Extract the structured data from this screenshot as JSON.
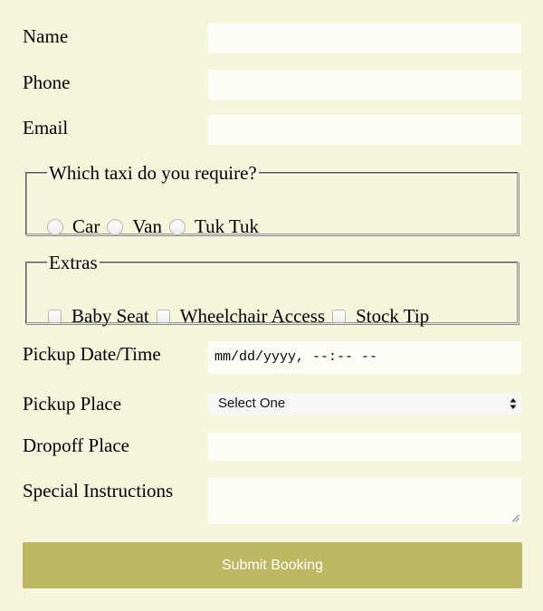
{
  "fields": {
    "name": {
      "label": "Name",
      "value": ""
    },
    "phone": {
      "label": "Phone",
      "value": ""
    },
    "email": {
      "label": "Email",
      "value": ""
    },
    "pickup_datetime": {
      "label": "Pickup Date/Time",
      "placeholder": "mm/dd/yyyy, --:-- --"
    },
    "pickup_place": {
      "label": "Pickup Place",
      "selected": "Select One"
    },
    "dropoff_place": {
      "label": "Dropoff Place",
      "value": ""
    },
    "special_instructions": {
      "label": "Special Instructions",
      "value": ""
    }
  },
  "taxi_group": {
    "legend": "Which taxi do you require?",
    "options": [
      {
        "label": "Car",
        "checked": false
      },
      {
        "label": "Van",
        "checked": false
      },
      {
        "label": "Tuk Tuk",
        "checked": false
      }
    ]
  },
  "extras_group": {
    "legend": "Extras",
    "options": [
      {
        "label": "Baby Seat",
        "checked": false
      },
      {
        "label": "Wheelchair Access",
        "checked": false
      },
      {
        "label": "Stock Tip",
        "checked": false
      }
    ]
  },
  "submit": {
    "label": "Submit Booking"
  },
  "colors": {
    "background": "#f5f5dc",
    "input_bg": "#fdfdf7",
    "button": "#bdb762",
    "button_text": "#ffffff"
  },
  "icons": {
    "select_arrows": "select-arrows-icon",
    "resize_grip": "resize-grip-icon"
  }
}
